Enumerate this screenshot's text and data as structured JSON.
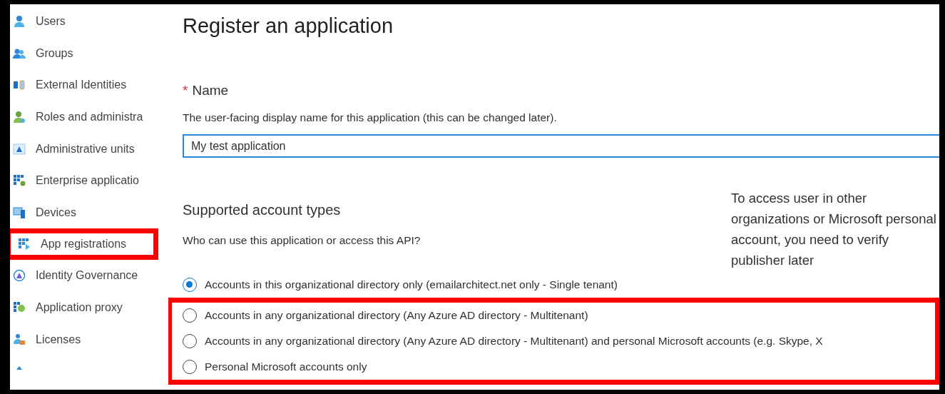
{
  "sidebar": {
    "items": [
      {
        "label": "Users",
        "highlighted": false
      },
      {
        "label": "Groups",
        "highlighted": false
      },
      {
        "label": "External Identities",
        "highlighted": false
      },
      {
        "label": "Roles and administra",
        "highlighted": false
      },
      {
        "label": "Administrative units",
        "highlighted": false
      },
      {
        "label": "Enterprise applicatio",
        "highlighted": false
      },
      {
        "label": "Devices",
        "highlighted": false
      },
      {
        "label": "App registrations",
        "highlighted": true
      },
      {
        "label": "Identity Governance",
        "highlighted": false
      },
      {
        "label": "Application proxy",
        "highlighted": false
      },
      {
        "label": "Licenses",
        "highlighted": false
      }
    ]
  },
  "page": {
    "title": "Register an application",
    "name_field": {
      "required_mark": "*",
      "label": "Name",
      "description": "The user-facing display name for this application (this can be changed later).",
      "value": "My test application"
    },
    "account_types": {
      "heading": "Supported account types",
      "question": "Who can use this application or access this API?",
      "note": "To access user in other organizations or Microsoft personal account, you need to verify publisher later",
      "options": [
        {
          "label": "Accounts in this organizational directory only (emailarchitect.net only - Single tenant)",
          "selected": true,
          "highlighted": false
        },
        {
          "label": "Accounts in any organizational directory (Any Azure AD directory - Multitenant)",
          "selected": false,
          "highlighted": true
        },
        {
          "label": "Accounts in any organizational directory (Any Azure AD directory - Multitenant) and personal Microsoft accounts (e.g. Skype, X",
          "selected": false,
          "highlighted": true
        },
        {
          "label": "Personal Microsoft accounts only",
          "selected": false,
          "highlighted": true
        }
      ]
    }
  }
}
